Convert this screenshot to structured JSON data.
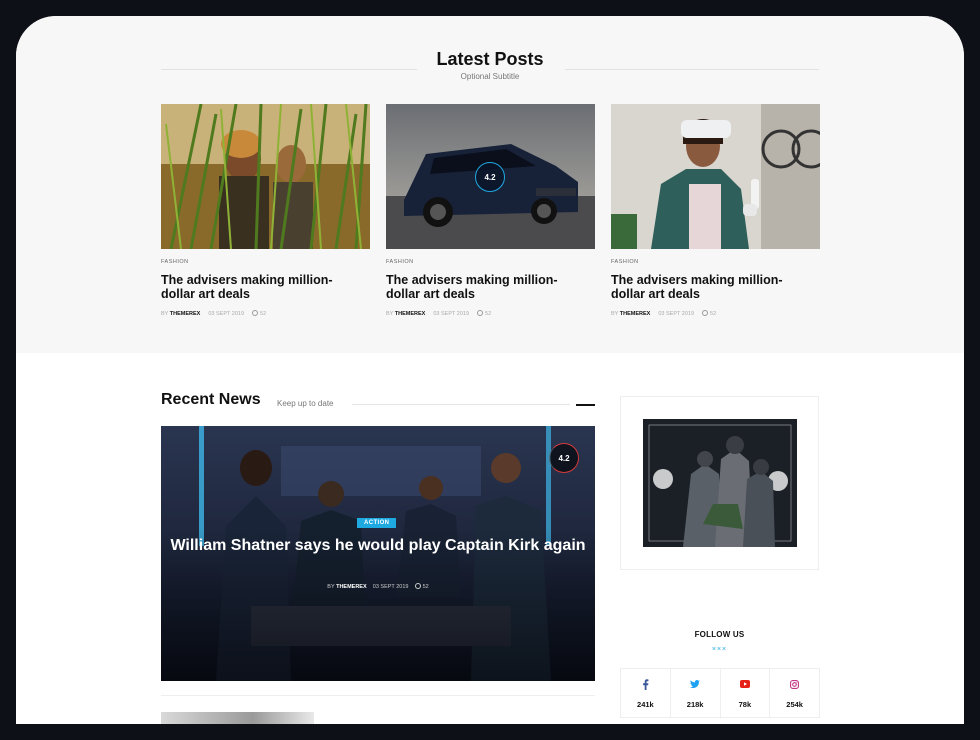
{
  "latest_posts": {
    "title": "Latest Posts",
    "subtitle": "Optional Subtitle",
    "cards": [
      {
        "category": "FASHION",
        "title": "The advisers making million-dollar art deals",
        "by": "BY",
        "author": "THEMEREX",
        "date": "03 SEPT 2019",
        "comments": "52",
        "image": "people-in-tall-grass"
      },
      {
        "category": "FASHION",
        "title": "The advisers making million-dollar art deals",
        "by": "BY",
        "author": "THEMEREX",
        "date": "03 SEPT 2019",
        "comments": "52",
        "image": "dark-suv-on-road",
        "rating": "4.2"
      },
      {
        "category": "FASHION",
        "title": "The advisers making million-dollar art deals",
        "by": "BY",
        "author": "THEMEREX",
        "date": "03 SEPT 2019",
        "comments": "52",
        "image": "woman-with-vr-headset"
      }
    ]
  },
  "recent_news": {
    "title": "Recent News",
    "subtitle": "Keep up to date",
    "hero": {
      "tag": "ACTION",
      "title": "William Shatner says he would play Captain Kirk again",
      "by": "BY",
      "author": "THEMEREX",
      "date": "03 SEPT 2019",
      "comments": "52",
      "rating": "4.2",
      "image": "sci-fi-cast-group"
    }
  },
  "sidebar": {
    "ad_image": "armored-soldiers-game-art",
    "follow_title": "FOLLOW US",
    "follow_divider": "×××",
    "socials": [
      {
        "icon": "facebook-icon",
        "count": "241k",
        "color": "#3b5998"
      },
      {
        "icon": "twitter-icon",
        "count": "218k",
        "color": "#1da1f2"
      },
      {
        "icon": "youtube-icon",
        "count": "78k",
        "color": "#e62117"
      },
      {
        "icon": "instagram-icon",
        "count": "254k",
        "color": "#c13584"
      }
    ]
  },
  "colors": {
    "accent": "#1fa9e1",
    "rating_ring": "#d23a3a",
    "band_bg": "#f7f7f7"
  }
}
